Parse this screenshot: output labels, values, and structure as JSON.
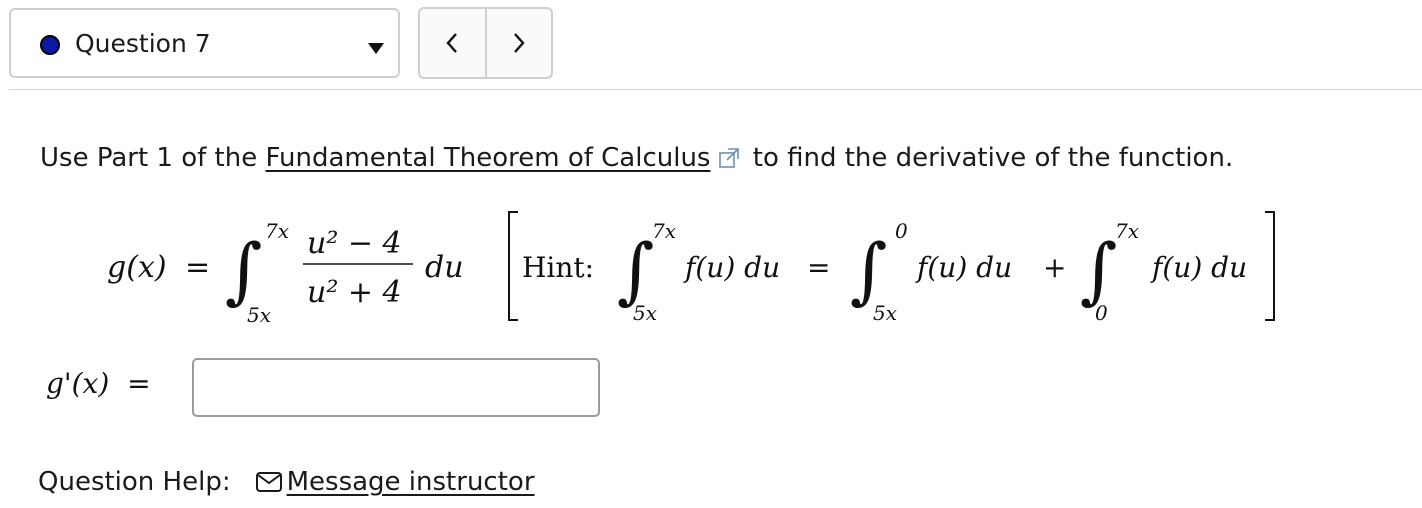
{
  "question_selector": {
    "label": "Question 7",
    "dot_color": "#0a1aa8",
    "icon": "chevron-down-icon"
  },
  "nav": {
    "prev_icon": "chevron-left-icon",
    "next_icon": "chevron-right-icon"
  },
  "instruction": {
    "before": "Use Part 1 of the ",
    "link": "Fundamental Theorem of Calculus",
    "after": " to find the derivative of the function.",
    "link_icon": "external-link-icon"
  },
  "formula": {
    "lhs": "g(x)",
    "equals": "=",
    "upper": "7x",
    "lower": "5x",
    "numerator": "u² − 4",
    "denominator": "u² + 4",
    "differential": "du",
    "hint_label": "Hint:",
    "hint_integrand": "f(u) du",
    "hint_equals": "=",
    "split_upper_1": "0",
    "split_lower_1": "5x",
    "plus": "+",
    "split_upper_2": "7x",
    "split_lower_2": "0"
  },
  "answer": {
    "label": "g'(x)",
    "equals": "=",
    "value": ""
  },
  "help": {
    "label": "Question Help:",
    "link": "Message instructor",
    "icon": "mail-icon"
  }
}
